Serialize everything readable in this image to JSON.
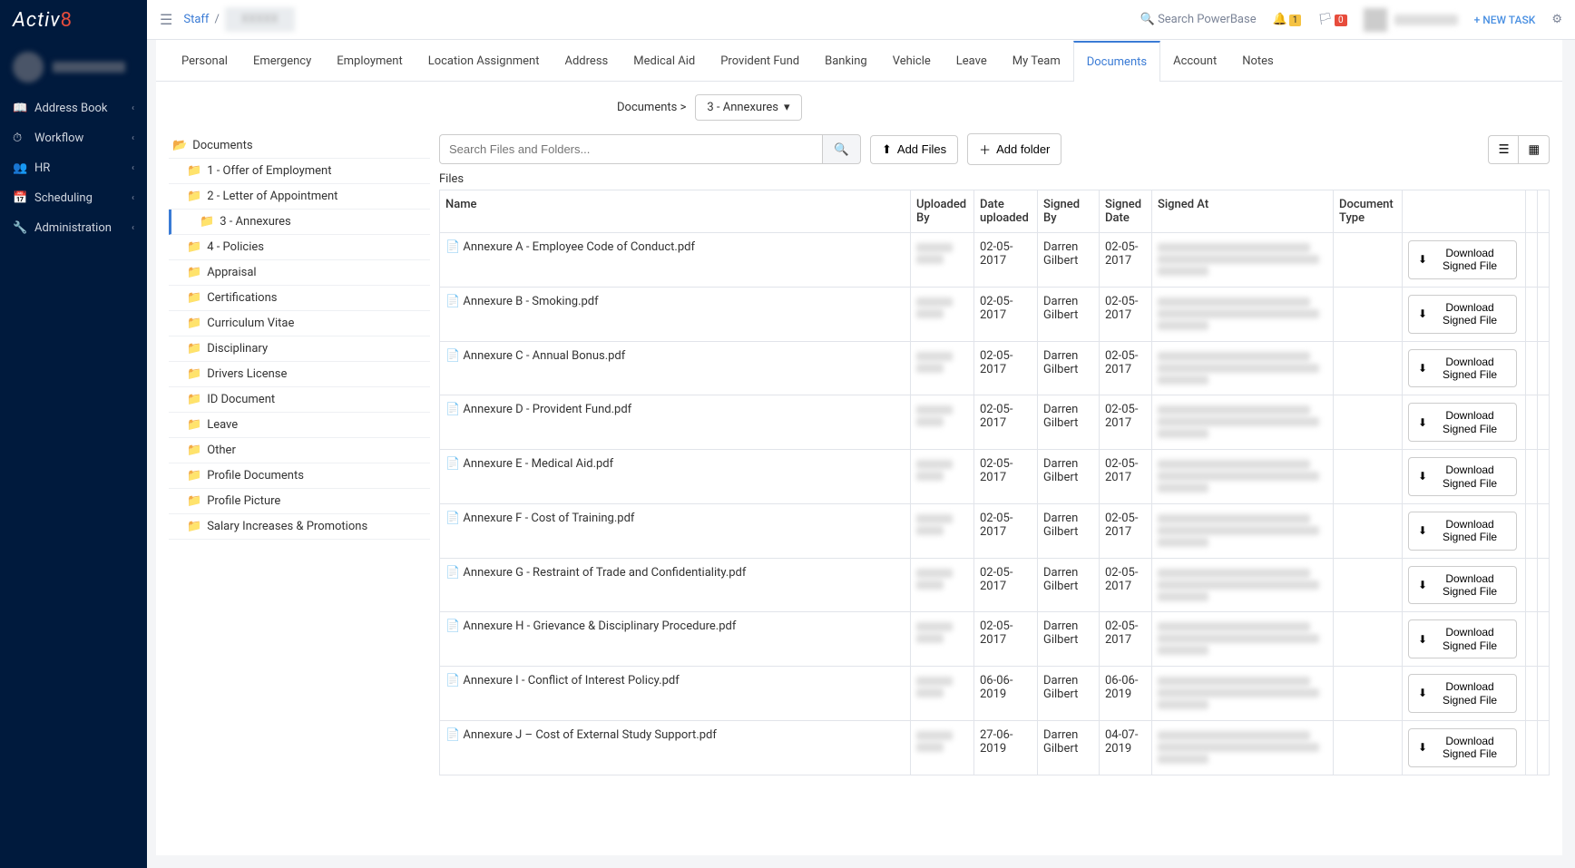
{
  "brand": {
    "part1": "Activ",
    "part2_red": "8",
    "part2_blue": ""
  },
  "sidebar": {
    "items": [
      {
        "icon": "📖",
        "label": "Address Book"
      },
      {
        "icon": "⏱",
        "label": "Workflow"
      },
      {
        "icon": "👥",
        "label": "HR"
      },
      {
        "icon": "📅",
        "label": "Scheduling"
      },
      {
        "icon": "🔧",
        "label": "Administration"
      }
    ]
  },
  "topbar": {
    "breadcrumb_root": "Staff",
    "search_label": "Search PowerBase",
    "bell_count": "1",
    "flag_count": "0",
    "new_task": "+  NEW TASK"
  },
  "tabs": [
    "Personal",
    "Emergency",
    "Employment",
    "Location Assignment",
    "Address",
    "Medical Aid",
    "Provident Fund",
    "Banking",
    "Vehicle",
    "Leave",
    "My Team",
    "Documents",
    "Account",
    "Notes"
  ],
  "tabs_active_index": 11,
  "doc_crumb": {
    "root": "Documents >",
    "current": "3 - Annexures"
  },
  "tree_root": "Documents",
  "tree": [
    "1 - Offer of Employment",
    "2 - Letter of Appointment",
    "3 - Annexures",
    "4 - Policies",
    "Appraisal",
    "Certifications",
    "Curriculum Vitae",
    "Disciplinary",
    "Drivers License",
    "ID Document",
    "Leave",
    "Other",
    "Profile Documents",
    "Profile Picture",
    "Salary Increases & Promotions"
  ],
  "tree_active_index": 2,
  "search_placeholder": "Search Files and Folders...",
  "toolbar": {
    "add_files": "Add Files",
    "add_folder": "Add folder"
  },
  "files_label": "Files",
  "columns": [
    "Name",
    "Uploaded By",
    "Date uploaded",
    "Signed By",
    "Signed Date",
    "Signed At",
    "Document Type",
    "",
    "",
    ""
  ],
  "download_label": "Download Signed File",
  "rows": [
    {
      "name": "Annexure A - Employee Code of Conduct.pdf",
      "date_uploaded": "02-05-2017",
      "signed_by": "Darren Gilbert",
      "signed_date": "02-05-2017"
    },
    {
      "name": "Annexure B - Smoking.pdf",
      "date_uploaded": "02-05-2017",
      "signed_by": "Darren Gilbert",
      "signed_date": "02-05-2017"
    },
    {
      "name": "Annexure C - Annual Bonus.pdf",
      "date_uploaded": "02-05-2017",
      "signed_by": "Darren Gilbert",
      "signed_date": "02-05-2017"
    },
    {
      "name": "Annexure D - Provident Fund.pdf",
      "date_uploaded": "02-05-2017",
      "signed_by": "Darren Gilbert",
      "signed_date": "02-05-2017"
    },
    {
      "name": "Annexure E - Medical Aid.pdf",
      "date_uploaded": "02-05-2017",
      "signed_by": "Darren Gilbert",
      "signed_date": "02-05-2017"
    },
    {
      "name": "Annexure F - Cost of Training.pdf",
      "date_uploaded": "02-05-2017",
      "signed_by": "Darren Gilbert",
      "signed_date": "02-05-2017"
    },
    {
      "name": "Annexure G - Restraint of Trade and Confidentiality.pdf",
      "date_uploaded": "02-05-2017",
      "signed_by": "Darren Gilbert",
      "signed_date": "02-05-2017"
    },
    {
      "name": "Annexure H - Grievance & Disciplinary Procedure.pdf",
      "date_uploaded": "02-05-2017",
      "signed_by": "Darren Gilbert",
      "signed_date": "02-05-2017"
    },
    {
      "name": "Annexure I - Conflict of Interest Policy.pdf",
      "date_uploaded": "06-06-2019",
      "signed_by": "Darren Gilbert",
      "signed_date": "06-06-2019"
    },
    {
      "name": "Annexure J – Cost of External Study Support.pdf",
      "date_uploaded": "27-06-2019",
      "signed_by": "Darren Gilbert",
      "signed_date": "04-07-2019"
    }
  ]
}
